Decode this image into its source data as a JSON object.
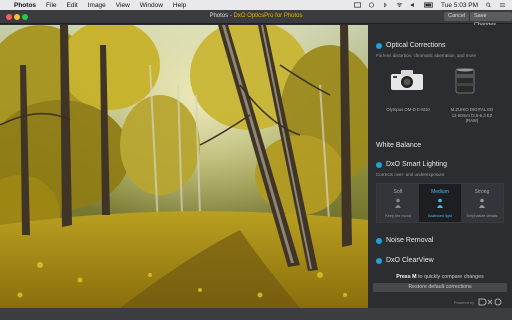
{
  "menubar": {
    "app": "Photos",
    "items": [
      "File",
      "Edit",
      "Image",
      "View",
      "Window",
      "Help"
    ],
    "clock": "Tue 5:03 PM"
  },
  "window": {
    "title_prefix": "Photos - ",
    "title_dxo": "DxO OpticsPro for Photos",
    "cancel_label": "Cancel",
    "save_label": "Save Changes"
  },
  "panel": {
    "optical": {
      "title": "Optical Corrections",
      "description": "Fix lens distortion, chromatic aberration, and more",
      "camera_caption": "Olympus OM-D E-M10",
      "lens_caption_1": "M.ZUIKO DIGITAL ED",
      "lens_caption_2": "12-50mm f3.5-6.3 EZ",
      "lens_caption_3": "(RAW)"
    },
    "white_balance": "White Balance",
    "smart_lighting": {
      "title": "DxO Smart Lighting",
      "description": "Corrects over- and underexposure",
      "options": [
        {
          "label": "Soft",
          "desc": "Keep the mood"
        },
        {
          "label": "Medium",
          "desc": "Balanced light"
        },
        {
          "label": "Strong",
          "desc": "Emphasize details"
        }
      ]
    },
    "noise": "Noise Removal",
    "clearview": "DxO ClearView",
    "press_key": "Press M",
    "press_rest": " to quickly compare changes",
    "restore": "Restore default corrections",
    "powered": "Powered by",
    "logo": "DxO"
  },
  "colors": {
    "accent": "#1aa3de",
    "brand": "#f0b400"
  }
}
